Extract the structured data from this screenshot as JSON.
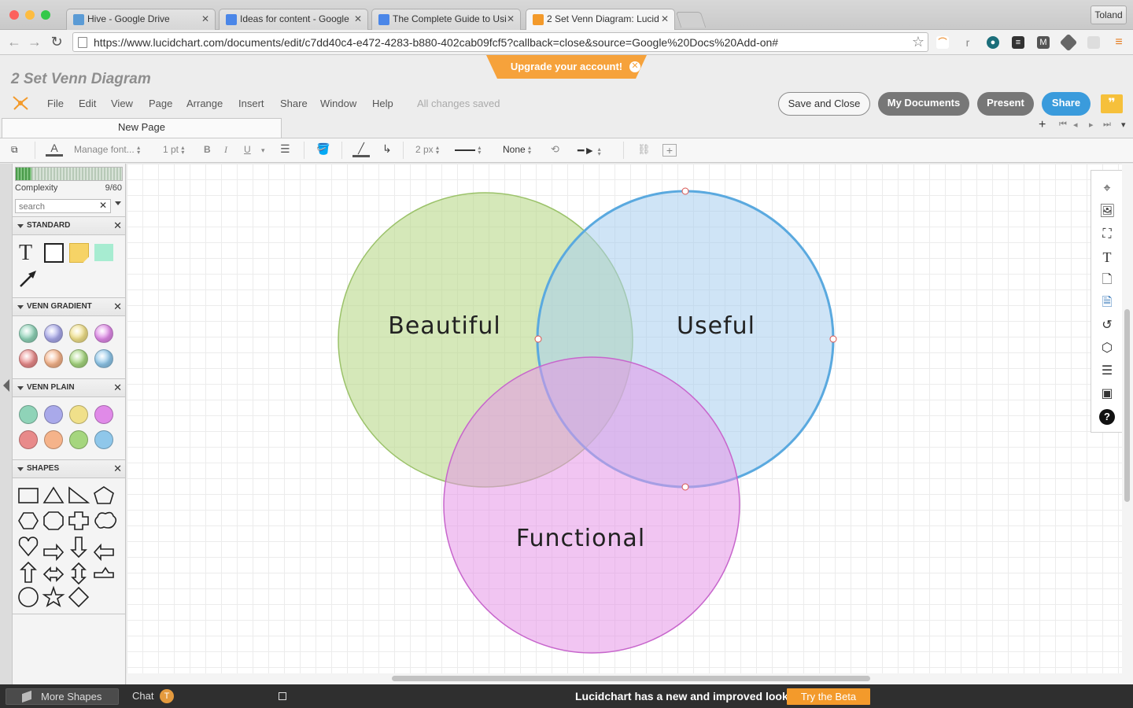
{
  "browser": {
    "tabs": [
      {
        "title": "Hive - Google Drive",
        "favicon_color": "#5b9bd5"
      },
      {
        "title": "Ideas for content - Google",
        "favicon_color": "#4a86e8"
      },
      {
        "title": "The Complete Guide to Usi",
        "favicon_color": "#4a86e8"
      },
      {
        "title": "2 Set Venn Diagram: Lucid",
        "favicon_color": "#f39a2b"
      }
    ],
    "user": "Toland",
    "url": "https://www.lucidchart.com/documents/edit/c7dd40c4-e472-4283-b880-402cab09fcf5?callback=close&source=Google%20Docs%20Add-on#"
  },
  "app": {
    "doc_title": "2 Set Venn Diagram",
    "upgrade_text": "Upgrade your account!",
    "menu": [
      "File",
      "Edit",
      "View",
      "Page",
      "Arrange",
      "Insert",
      "Share",
      "Window",
      "Help"
    ],
    "save_status": "All changes saved",
    "buttons": {
      "save_close": "Save and Close",
      "my_documents": "My Documents",
      "present": "Present",
      "share": "Share"
    },
    "page_tab": "New Page",
    "accent": "#3a9bdc"
  },
  "toolbar": {
    "font": "Manage font...",
    "font_size": "1 pt",
    "bold": "B",
    "italic": "I",
    "underline": "U",
    "line_width": "2 px",
    "arrow_start": "None"
  },
  "left_panel": {
    "complexity_label": "Complexity",
    "complexity_value": "9/60",
    "complexity_fraction": 0.15,
    "search_placeholder": "search",
    "sections": {
      "standard": "STANDARD",
      "venn_gradient": "VENN GRADIENT",
      "venn_plain": "VENN PLAIN",
      "shapes": "SHAPES"
    },
    "standard_text_tool": "T",
    "venn_colors": [
      "#8fd3b8",
      "#a9a9ea",
      "#f0e08a",
      "#e08ae8",
      "#e88a8a",
      "#f5b38a",
      "#a5d67e",
      "#8fc7ea"
    ]
  },
  "diagram": {
    "circles": [
      {
        "label": "Beautiful",
        "fill": "#b9d98a",
        "stroke": "#9bc26a"
      },
      {
        "label": "Useful",
        "fill": "#a8cdef",
        "stroke": "#5aa9df"
      },
      {
        "label": "Functional",
        "fill": "#e596e8",
        "stroke": "#c766cc"
      }
    ]
  },
  "bottom_bar": {
    "more_shapes": "More Shapes",
    "chat": "Chat",
    "chat_avatar": "T",
    "new_look": "Lucidchart has a new and improved look.",
    "try_beta": "Try the Beta"
  }
}
